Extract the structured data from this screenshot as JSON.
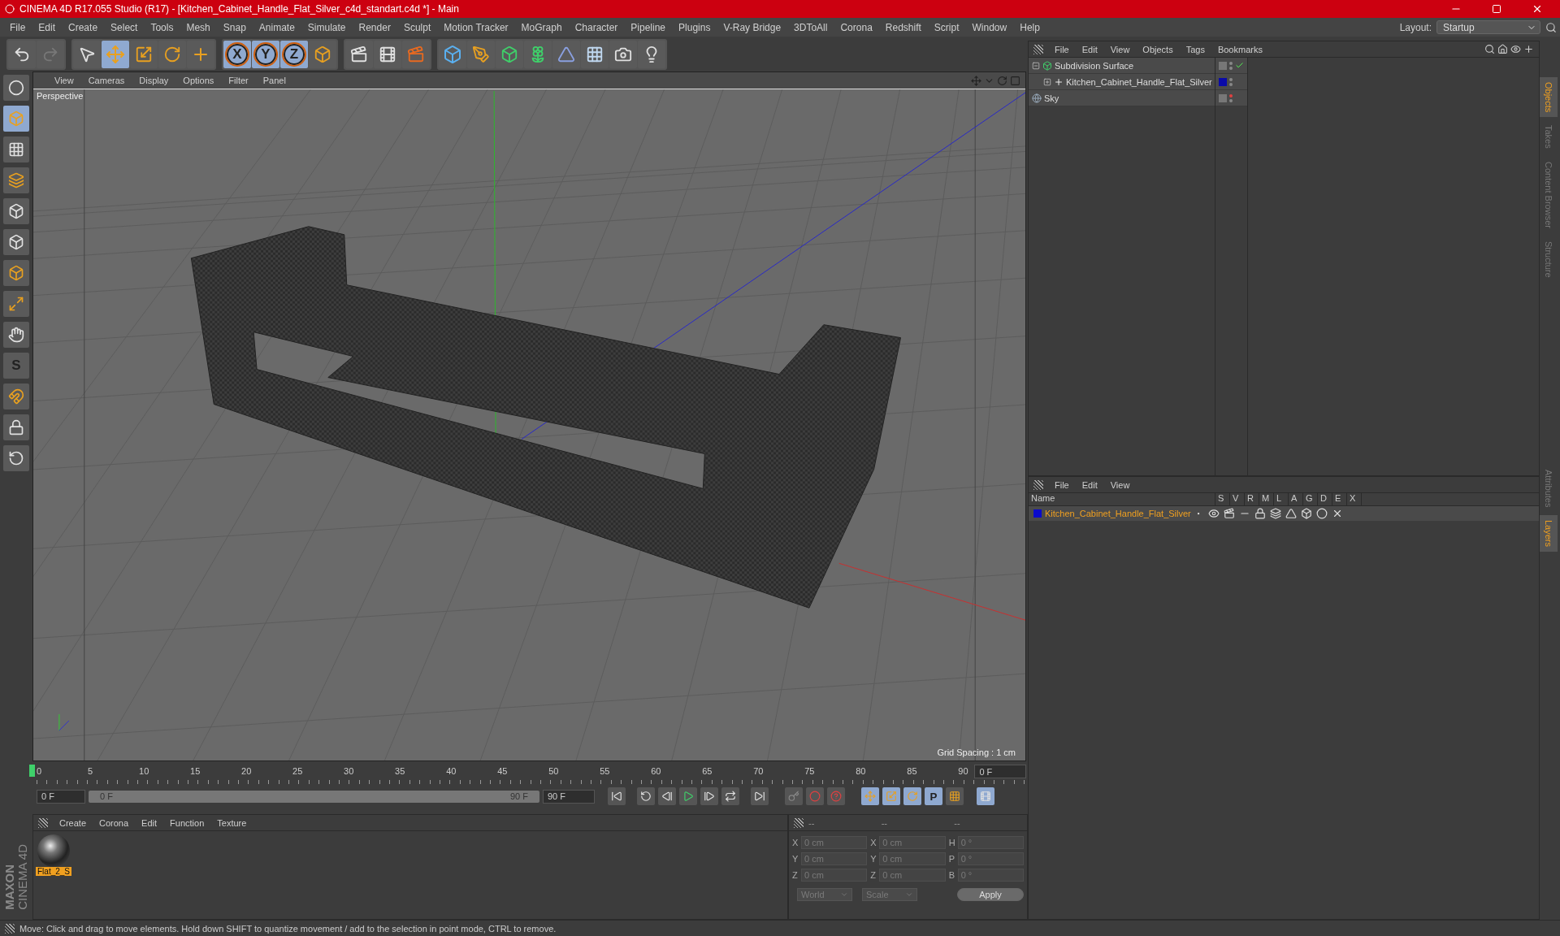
{
  "window": {
    "title": "CINEMA 4D R17.055 Studio (R17) - [Kitchen_Cabinet_Handle_Flat_Silver_c4d_standart.c4d *] - Main"
  },
  "menu": [
    "File",
    "Edit",
    "Create",
    "Select",
    "Tools",
    "Mesh",
    "Snap",
    "Animate",
    "Simulate",
    "Render",
    "Sculpt",
    "Motion Tracker",
    "MoGraph",
    "Character",
    "Pipeline",
    "Plugins",
    "V-Ray Bridge",
    "3DToAll",
    "Corona",
    "Redshift",
    "Script",
    "Window",
    "Help"
  ],
  "layout": {
    "label": "Layout:",
    "value": "Startup"
  },
  "axis_locks": [
    {
      "label": "X",
      "on": true
    },
    {
      "label": "Y",
      "on": true
    },
    {
      "label": "Z",
      "on": true
    }
  ],
  "snap_glyph": "S",
  "viewport": {
    "menu": [
      "View",
      "Cameras",
      "Display",
      "Options",
      "Filter",
      "Panel"
    ],
    "camera": "Perspective",
    "grid_spacing": "Grid Spacing : 1 cm"
  },
  "timeline": {
    "ticks": [
      "0",
      "5",
      "10",
      "15",
      "20",
      "25",
      "30",
      "35",
      "40",
      "45",
      "50",
      "55",
      "60",
      "65",
      "70",
      "75",
      "80",
      "85",
      "90"
    ],
    "current": "0 F",
    "start": "0 F",
    "range": {
      "start": "0 F",
      "end": "90 F",
      "level": 1
    },
    "end": "90 F",
    "keyframe_glyph": "P"
  },
  "materials": {
    "menu": [
      "Create",
      "Corona",
      "Edit",
      "Function",
      "Texture"
    ],
    "items": [
      {
        "name": "Flat_2_S",
        "selected": true
      }
    ]
  },
  "brand": [
    "MAXON",
    "CINEMA 4D"
  ],
  "coordinates": {
    "headers": [
      "--",
      "--",
      "--"
    ],
    "columns": [
      [
        {
          "axis": "X",
          "value": "0 cm"
        },
        {
          "axis": "Y",
          "value": "0 cm"
        },
        {
          "axis": "Z",
          "value": "0 cm"
        }
      ],
      [
        {
          "axis": "X",
          "value": "0 cm"
        },
        {
          "axis": "Y",
          "value": "0 cm"
        },
        {
          "axis": "Z",
          "value": "0 cm"
        }
      ],
      [
        {
          "axis": "H",
          "value": "0 °"
        },
        {
          "axis": "P",
          "value": "0 °"
        },
        {
          "axis": "B",
          "value": "0 °"
        }
      ]
    ],
    "dropdowns": [
      "World",
      "Scale"
    ],
    "apply": "Apply",
    "disabled": true
  },
  "objects": {
    "menu": [
      "File",
      "Edit",
      "View",
      "Objects",
      "Tags",
      "Bookmarks"
    ],
    "tree": [
      {
        "name": "Subdivision Surface",
        "kind": "subdivision",
        "expanded": true,
        "enabled": true,
        "render_visible": true,
        "children": [
          {
            "name": "Kitchen_Cabinet_Handle_Flat_Silver",
            "kind": "null",
            "expanded": false,
            "color": "#0a0aa8",
            "render_visible": true
          }
        ]
      },
      {
        "name": "Sky",
        "kind": "sky",
        "render_visible": false
      }
    ]
  },
  "layers": {
    "menu": [
      "File",
      "Edit",
      "View"
    ],
    "columns": [
      "Name",
      "S",
      "V",
      "R",
      "M",
      "L",
      "A",
      "G",
      "D",
      "E",
      "X"
    ],
    "items": [
      {
        "name": "Kitchen_Cabinet_Handle_Flat_Silver",
        "color": "#0a0acc"
      }
    ]
  },
  "side_tabs_top": [
    {
      "label": "Objects",
      "selected": true
    },
    {
      "label": "Takes",
      "selected": false
    },
    {
      "label": "Content Browser",
      "selected": false
    },
    {
      "label": "Structure",
      "selected": false
    }
  ],
  "side_tabs_bottom": [
    {
      "label": "Attributes",
      "selected": false
    },
    {
      "label": "Layers",
      "selected": true
    }
  ],
  "status_bar": "Move: Click and drag to move elements. Hold down SHIFT to quantize movement / add to the selection in point mode, CTRL to remove."
}
